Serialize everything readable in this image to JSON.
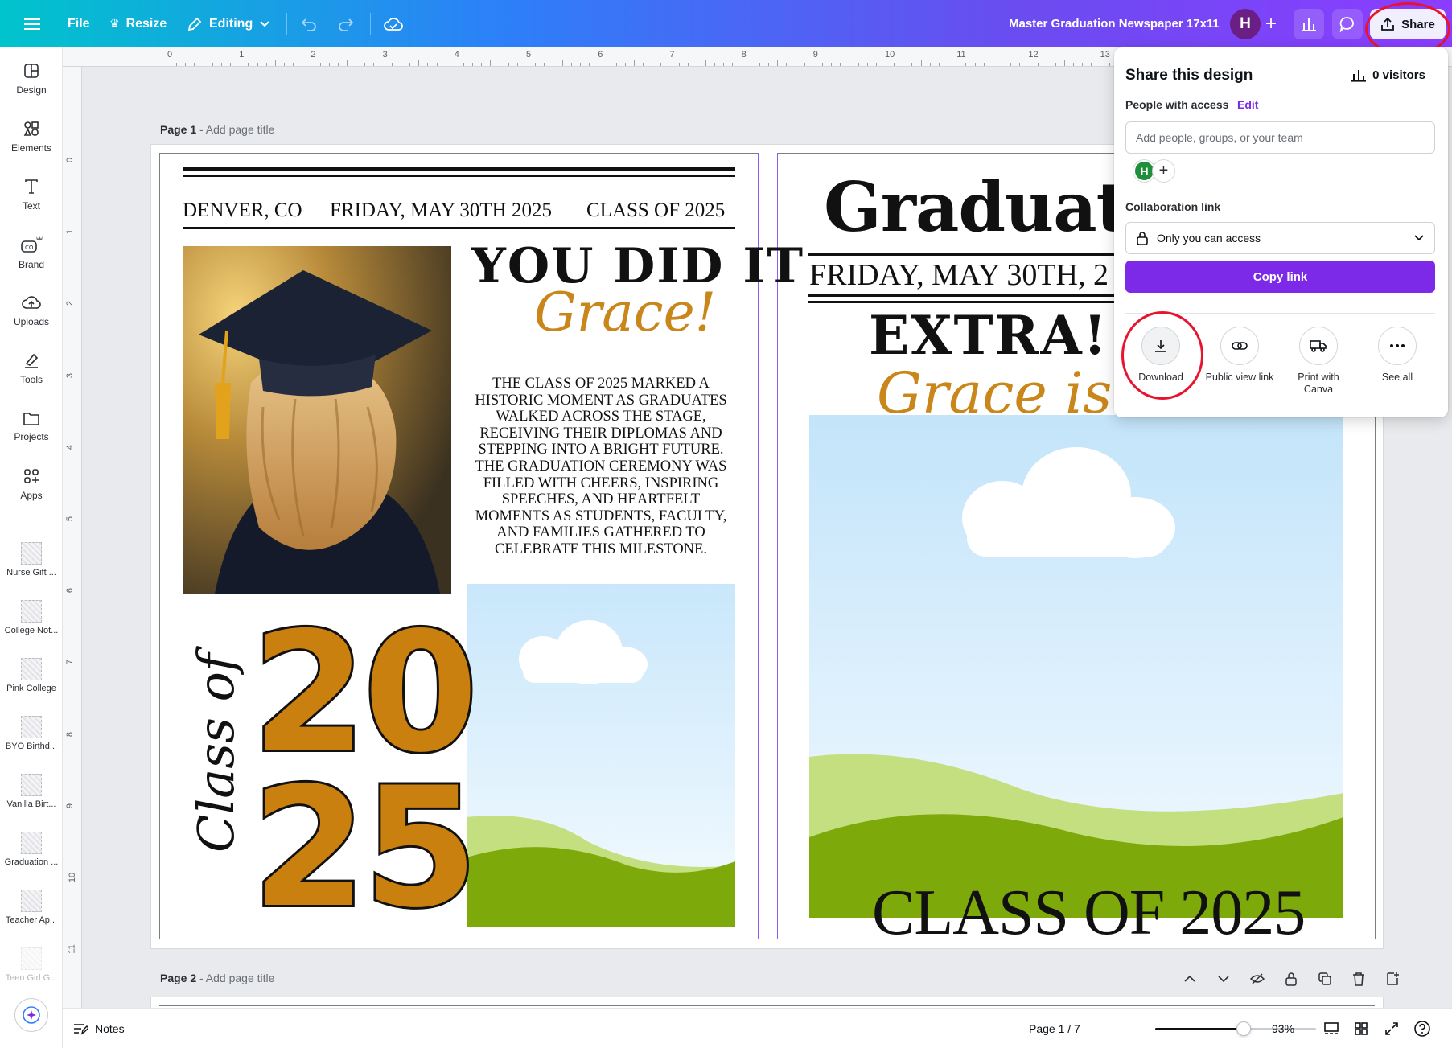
{
  "topbar": {
    "file_label": "File",
    "resize_label": "Resize",
    "mode_label": "Editing",
    "doc_title": "Master Graduation Newspaper 17x11",
    "avatar_initial": "H",
    "share_label": "Share"
  },
  "rail": {
    "items": [
      {
        "label": "Design",
        "icon": "design-icon"
      },
      {
        "label": "Elements",
        "icon": "elements-icon"
      },
      {
        "label": "Text",
        "icon": "text-icon"
      },
      {
        "label": "Brand",
        "icon": "brand-icon"
      },
      {
        "label": "Uploads",
        "icon": "uploads-icon"
      },
      {
        "label": "Tools",
        "icon": "tools-icon"
      },
      {
        "label": "Projects",
        "icon": "projects-icon"
      },
      {
        "label": "Apps",
        "icon": "apps-icon"
      }
    ],
    "recent": [
      "Nurse Gift ...",
      "College Not...",
      "Pink College",
      "BYO Birthd...",
      "Vanilla Birt...",
      "Graduation ...",
      "Teacher Ap...",
      "Teen Girl G..."
    ]
  },
  "ruler": {
    "top": [
      "0",
      "1",
      "2",
      "3",
      "4",
      "5",
      "6",
      "7",
      "8",
      "9",
      "10",
      "11",
      "12",
      "13"
    ],
    "left": [
      "0",
      "1",
      "2",
      "3",
      "4",
      "5",
      "6",
      "7",
      "8",
      "9",
      "10",
      "11",
      "0"
    ]
  },
  "page1": {
    "label": "Page 1",
    "sub": " - Add page title"
  },
  "page2": {
    "label": "Page 2",
    "sub": " - Add page title"
  },
  "newspaper": {
    "left": {
      "dateline_city": "DENVER, CO",
      "dateline_date": "FRIDAY, MAY 30TH 2025",
      "dateline_class": "CLASS OF 2025",
      "headline": "YOU DID IT",
      "name_script": "Grace!",
      "article": "THE CLASS OF 2025 MARKED A HISTORIC MOMENT AS GRADUATES WALKED ACROSS THE STAGE, RECEIVING THEIR DIPLOMAS AND STEPPING INTO A BRIGHT FUTURE. THE GRADUATION CEREMONY WAS FILLED WITH CHEERS, INSPIRING SPEECHES, AND HEARTFELT MOMENTS AS STUDENTS, FACULTY, AND FAMILIES GATHERED TO CELEBRATE THIS MILESTONE.",
      "class_of_script": "Class of",
      "year_top": "20",
      "year_bottom": "25"
    },
    "right": {
      "masthead": "Graduatio",
      "date": "FRIDAY, MAY 30TH, 2",
      "extra": "EXTRA! E",
      "script": "Grace is G",
      "footer": "CLASS OF 2025"
    }
  },
  "share_panel": {
    "title": "Share this design",
    "visitors": "0 visitors",
    "people_label": "People with access",
    "edit_label": "Edit",
    "input_placeholder": "Add people, groups, or your team",
    "avatar_initial": "H",
    "collab_label": "Collaboration link",
    "access_value": "Only you can access",
    "copy_label": "Copy link",
    "actions": [
      {
        "label": "Download",
        "icon": "download-icon"
      },
      {
        "label": "Public view link",
        "icon": "link-icon"
      },
      {
        "label": "Print with Canva",
        "icon": "truck-icon"
      },
      {
        "label": "See all",
        "icon": "more-icon"
      }
    ]
  },
  "bottombar": {
    "notes_label": "Notes",
    "page_indicator": "Page 1 / 7",
    "zoom": "93%",
    "zoom_fraction": 0.55
  },
  "colors": {
    "accent_purple": "#7d2ae8",
    "gold": "#c9861a",
    "highlight_red": "#e8132e"
  }
}
